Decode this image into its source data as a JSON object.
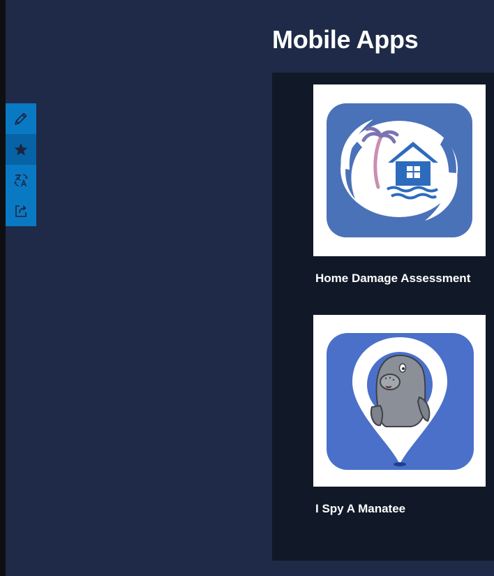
{
  "page": {
    "title": "Mobile Apps"
  },
  "toolbar": {
    "items": [
      {
        "name": "edit",
        "icon": "pencil-icon"
      },
      {
        "name": "favorite",
        "icon": "star-icon"
      },
      {
        "name": "translate",
        "icon": "translate-icon"
      },
      {
        "name": "share",
        "icon": "share-icon"
      }
    ]
  },
  "apps": [
    {
      "title": "Home Damage Assessment",
      "icon": "house-hurricane-icon"
    },
    {
      "title": "I Spy A Manatee",
      "icon": "manatee-pin-icon"
    }
  ],
  "colors": {
    "background": "#1e2a47",
    "panel": "#111827",
    "toolbar": "#0a79c4",
    "toolbar_active": "#0763a5",
    "app_icon_blue": "#4a76c2"
  }
}
